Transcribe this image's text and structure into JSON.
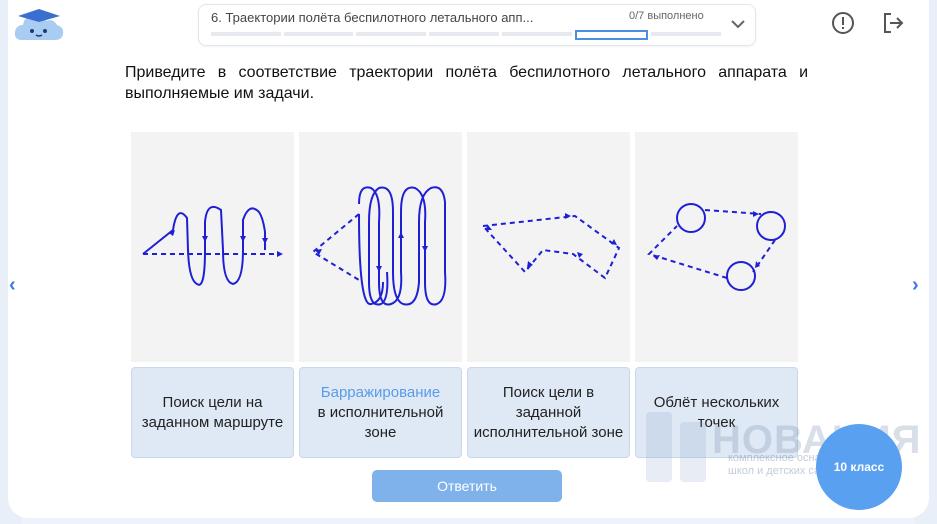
{
  "header": {
    "task_title": "6. Траектории полёта беспилотного летального апп...",
    "status": "0/7 выполнено",
    "segments": 7,
    "current_segment": 5
  },
  "question": "Приведите в соответствие траектории полёта беспилотного летального аппарата и выполняемые им задачи.",
  "cards": [
    {
      "name": "trajectory-snake"
    },
    {
      "name": "trajectory-loops"
    },
    {
      "name": "trajectory-zigzag"
    },
    {
      "name": "trajectory-points"
    }
  ],
  "labels": [
    {
      "text": "Поиск цели на заданном маршруте"
    },
    {
      "highlight": "Барражирование",
      "rest": "в исполнительной зоне"
    },
    {
      "text": "Поиск цели в заданной исполнительной зоне"
    },
    {
      "text": "Облёт нескольких точек"
    }
  ],
  "answer_button": "Ответить",
  "watermark": {
    "brand": "НОВАЦИЯ",
    "line1": "комплексное оснащение",
    "line2": "школ и детских садов"
  },
  "grade_badge": "10 класс",
  "colors": {
    "accent": "#4a90e2",
    "line": "#1f1fd6",
    "label_bg": "#dfe9f5",
    "button": "#7fb2ea",
    "badge": "#5aa0f0"
  },
  "icons": {
    "logo": "cloud-mascot-icon",
    "info": "exclamation-circle-icon",
    "exit": "logout-icon",
    "dropdown": "chevron-down-icon",
    "prev": "chevron-left-icon",
    "next": "chevron-right-icon"
  }
}
